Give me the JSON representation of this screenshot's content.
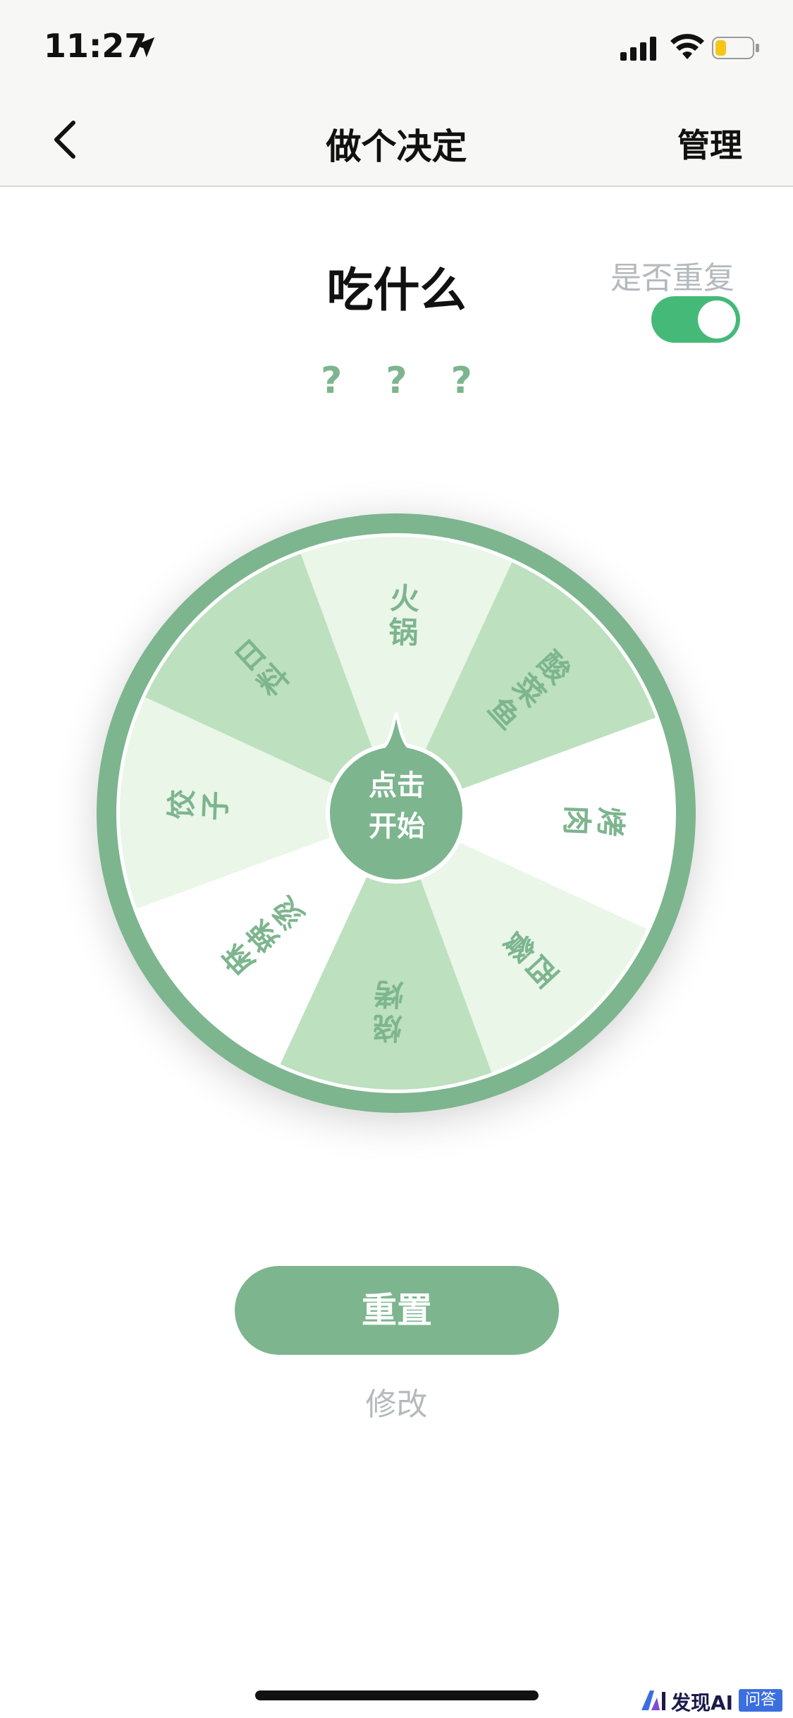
{
  "status_bar": {
    "time": "11:27",
    "icons": [
      "location-arrow-icon",
      "cellular-signal-icon",
      "wifi-icon",
      "battery-icon"
    ],
    "battery_level": 0.3
  },
  "nav": {
    "back_icon": "chevron-left-icon",
    "title": "做个决定",
    "manage_label": "管理"
  },
  "topic": {
    "title": "吃什么",
    "repeat_label": "是否重复",
    "repeat_enabled": true,
    "result_placeholder": "? ? ?"
  },
  "wheel": {
    "start_label_line1": "点击",
    "start_label_line2": "开始",
    "segments": [
      {
        "label": "火锅",
        "color": "#e9f6e8"
      },
      {
        "label": "酸菜鱼",
        "color": "#bde0bf"
      },
      {
        "label": "烤肉",
        "color": "#ffffff"
      },
      {
        "label": "西餐",
        "color": "#e9f6e8"
      },
      {
        "label": "烧烤",
        "color": "#bde0bf"
      },
      {
        "label": "麻辣烫",
        "color": "#ffffff"
      },
      {
        "label": "饺子",
        "color": "#e9f6e8"
      },
      {
        "label": "日料",
        "color": "#bde0bf"
      }
    ],
    "rim_color": "#7db58e"
  },
  "actions": {
    "reset_label": "重置",
    "edit_label": "修改"
  },
  "watermark": {
    "text": "发现AI",
    "badge": "问答"
  },
  "colors": {
    "accent": "#7db58e",
    "toggle_on": "#45ba78",
    "muted": "#b4b9bd"
  }
}
